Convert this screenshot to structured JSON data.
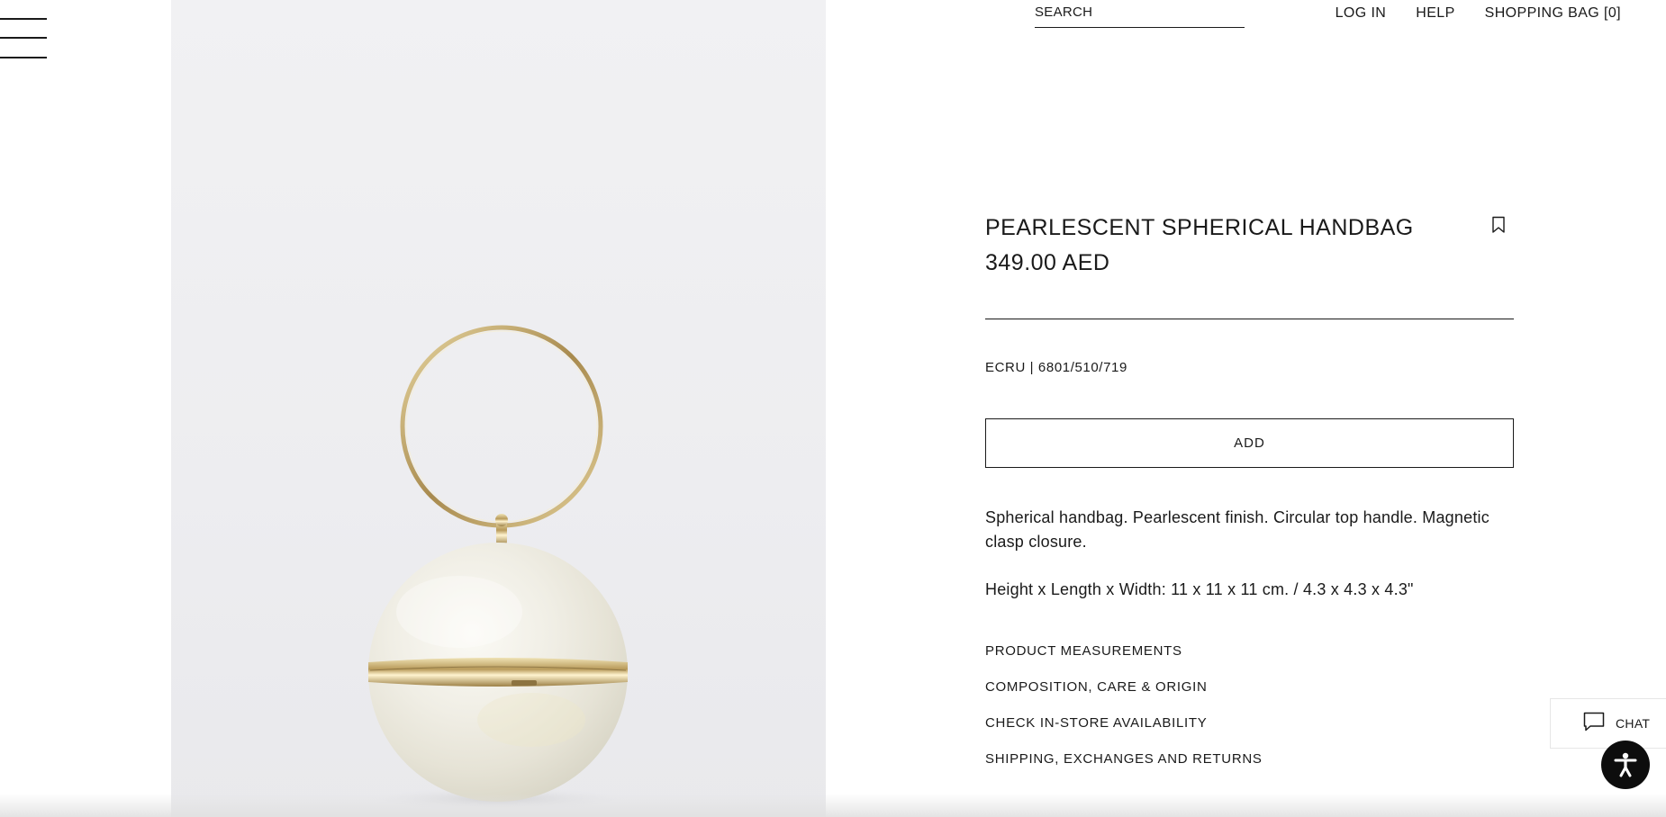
{
  "header": {
    "search_placeholder": "SEARCH",
    "nav": [
      {
        "label": "LOG IN"
      },
      {
        "label": "HELP"
      },
      {
        "label": "SHOPPING BAG [0]"
      }
    ]
  },
  "menu": {
    "icon": "hamburger-menu-icon"
  },
  "product": {
    "image_alt": "Pearlescent spherical handbag with gold circular top handle",
    "title": "PEARLESCENT SPHERICAL HANDBAG",
    "price": "349.00 AED",
    "bookmark_icon": "bookmark-icon",
    "reference": "ECRU | 6801/510/719",
    "add_label": "ADD",
    "description": "Spherical handbag. Pearlescent finish. Circular top handle. Magnetic clasp closure.",
    "dimensions": "Height x Length x Width: 11 x 11 x 11 cm. / 4.3 x 4.3 x 4.3\"",
    "links": [
      {
        "label": "PRODUCT MEASUREMENTS"
      },
      {
        "label": "COMPOSITION, CARE & ORIGIN"
      },
      {
        "label": "CHECK IN-STORE AVAILABILITY"
      },
      {
        "label": "SHIPPING, EXCHANGES AND RETURNS"
      }
    ]
  },
  "chat": {
    "label": "CHAT",
    "icon": "chat-bubble-icon"
  },
  "accessibility": {
    "icon": "accessibility-icon"
  },
  "colors": {
    "text": "#1a1a1a",
    "background": "#ffffff",
    "image_bg": "#efeff1",
    "gold": "#c8b27a",
    "pearl": "#f3f1ea"
  }
}
